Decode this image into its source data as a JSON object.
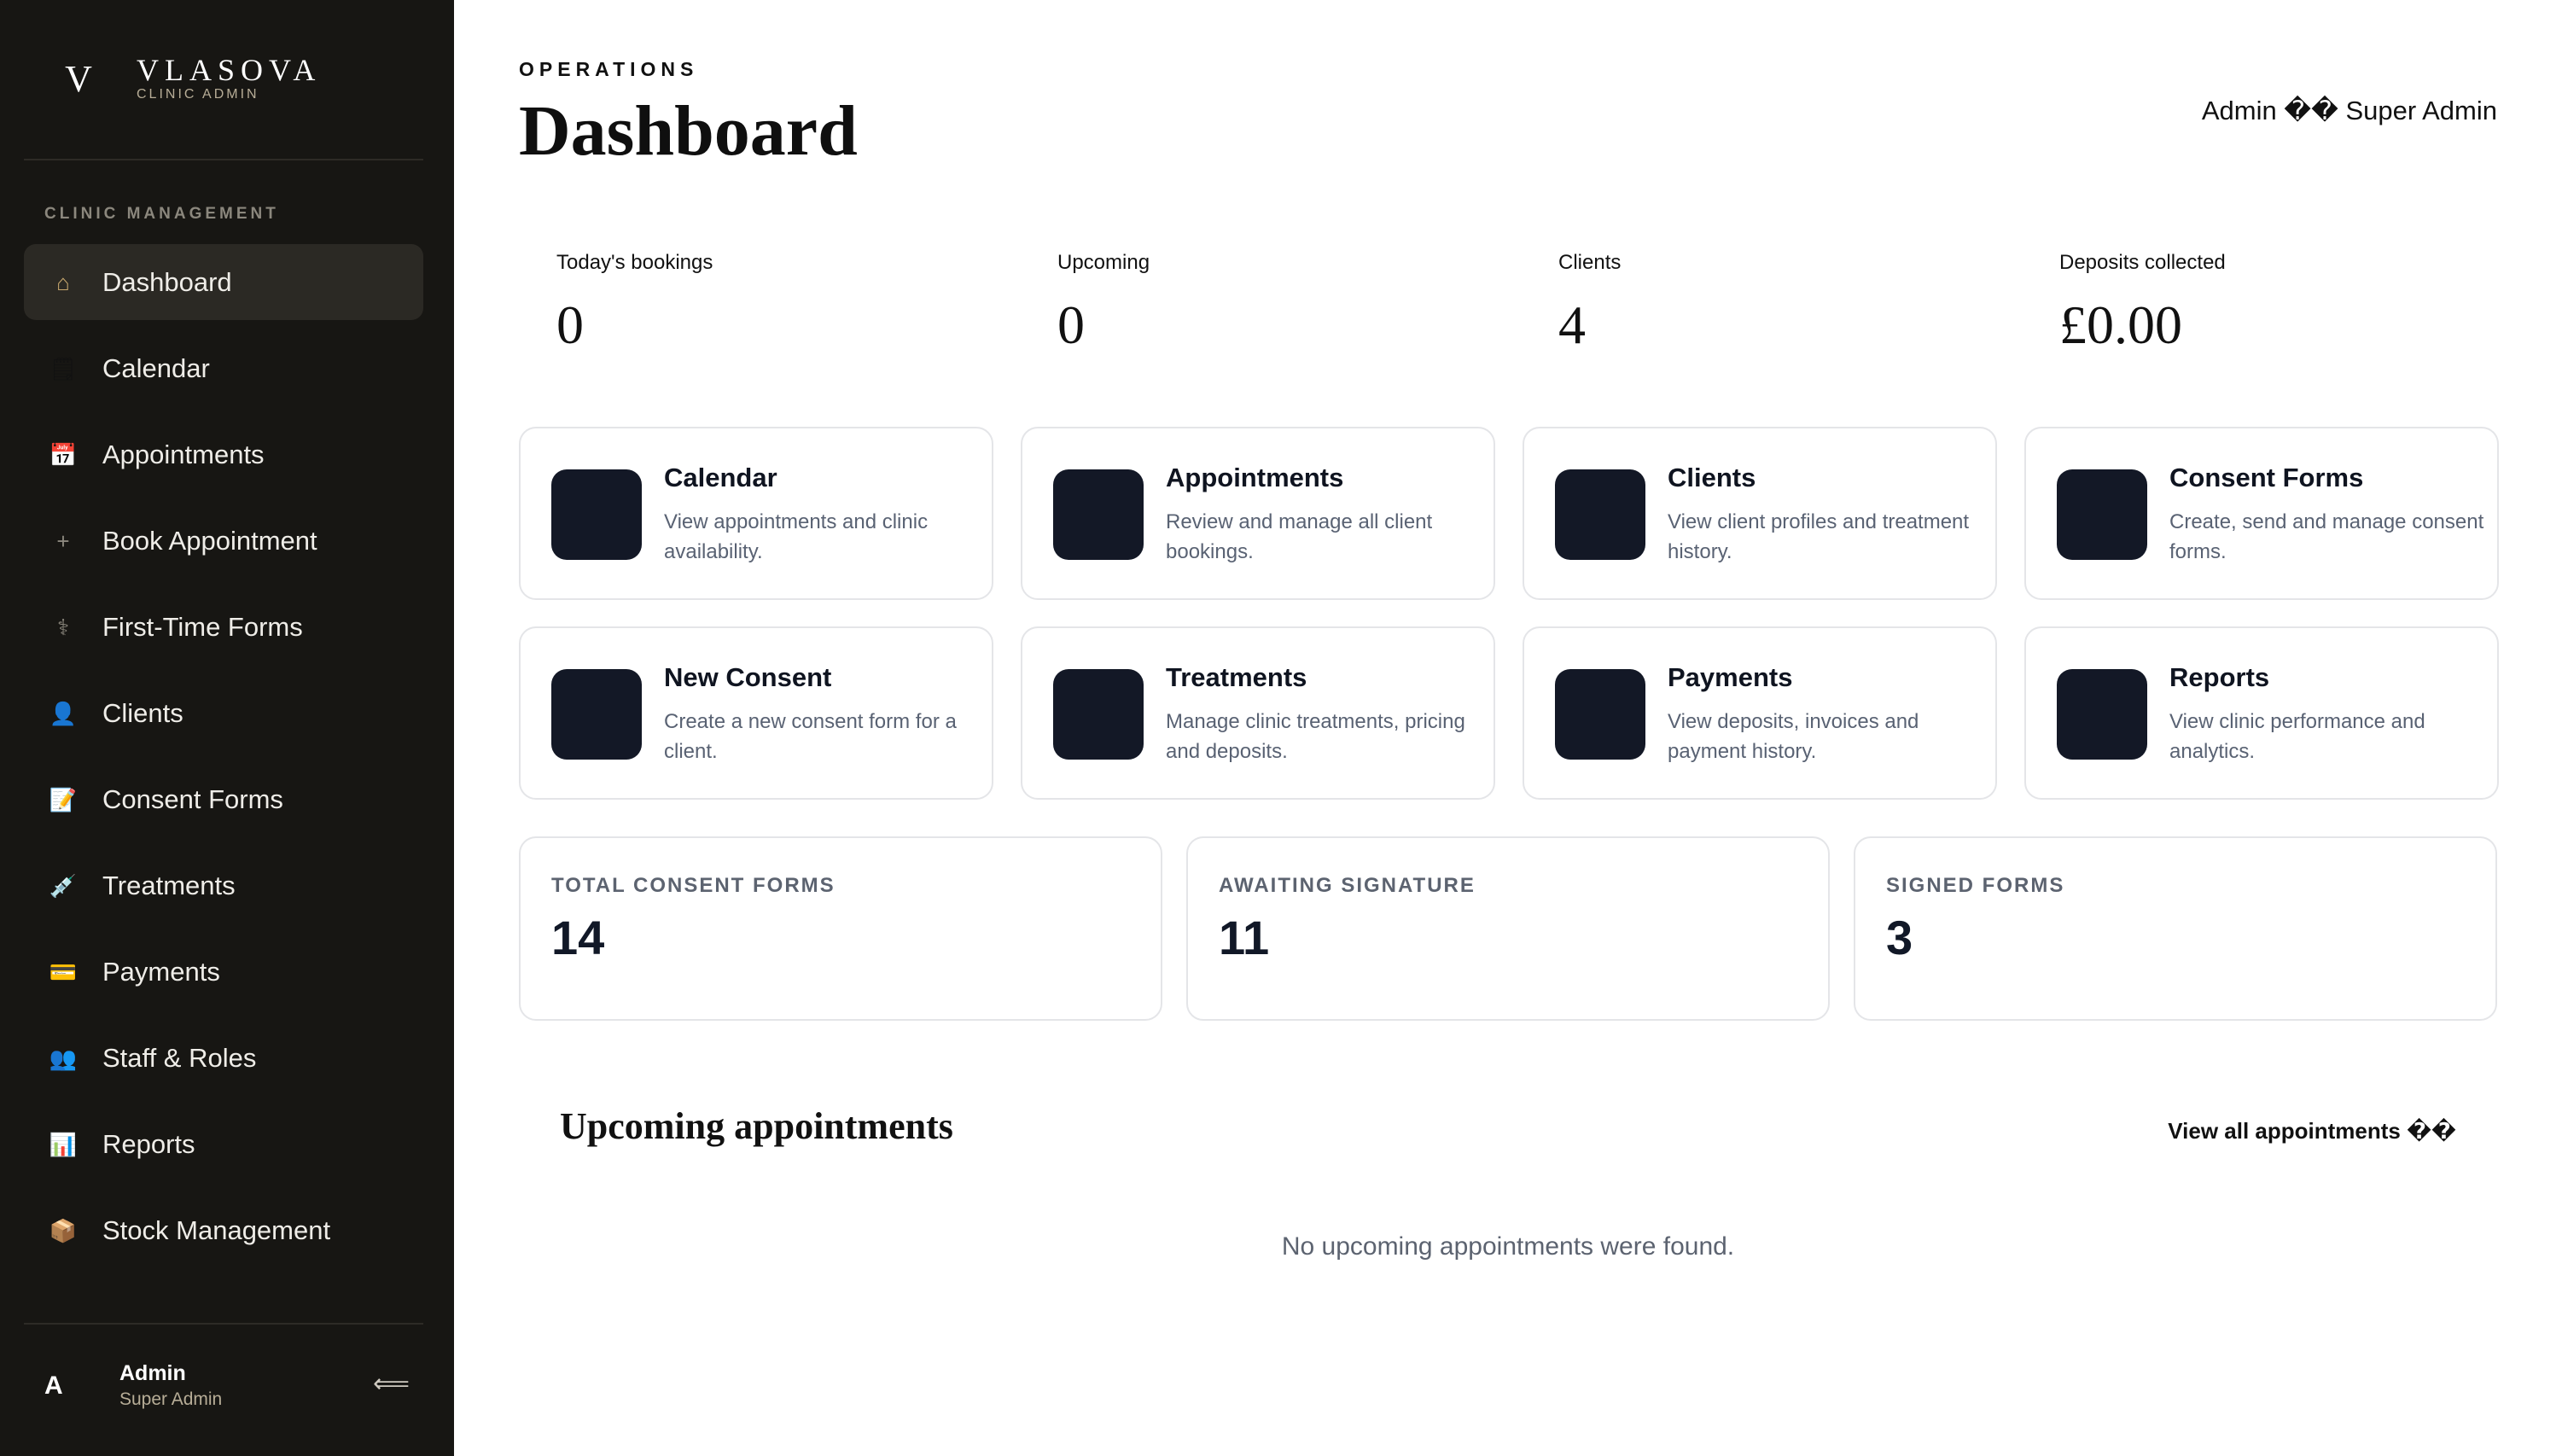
{
  "brand": {
    "mark": "V",
    "name": "VLASOVA",
    "subtitle": "CLINIC ADMIN"
  },
  "sidebar": {
    "section_label": "CLINIC MANAGEMENT",
    "items": [
      {
        "label": "Dashboard",
        "icon": "⌂",
        "icon_name": "home-icon",
        "active": true
      },
      {
        "label": "Calendar",
        "icon": "🗒",
        "icon_name": "calendar-icon"
      },
      {
        "label": "Appointments",
        "icon": "📅",
        "icon_name": "appointments-calendar-icon"
      },
      {
        "label": "Book Appointment",
        "icon": "+",
        "icon_name": "plus-icon"
      },
      {
        "label": "First-Time Forms",
        "icon": "⚕",
        "icon_name": "stethoscope-icon"
      },
      {
        "label": "Clients",
        "icon": "👤",
        "icon_name": "user-icon"
      },
      {
        "label": "Consent Forms",
        "icon": "📝",
        "icon_name": "memo-icon"
      },
      {
        "label": "Treatments",
        "icon": "💉",
        "icon_name": "syringe-icon"
      },
      {
        "label": "Payments",
        "icon": "💳",
        "icon_name": "credit-card-icon"
      },
      {
        "label": "Staff & Roles",
        "icon": "👥",
        "icon_name": "users-icon"
      },
      {
        "label": "Reports",
        "icon": "📊",
        "icon_name": "bar-chart-icon"
      },
      {
        "label": "Stock Management",
        "icon": "📦",
        "icon_name": "package-icon"
      }
    ],
    "user": {
      "avatar": "A",
      "name": "Admin",
      "role": "Super Admin",
      "logout_icon": "⟸"
    }
  },
  "header": {
    "eyebrow": "OPERATIONS",
    "title": "Dashboard",
    "admin_label": "Admin �� Super Admin"
  },
  "stats": [
    {
      "label": "Today's bookings",
      "value": "0"
    },
    {
      "label": "Upcoming",
      "value": "0"
    },
    {
      "label": "Clients",
      "value": "4"
    },
    {
      "label": "Deposits collected",
      "value": "£0.00"
    }
  ],
  "cards": [
    {
      "title": "Calendar",
      "desc": "View appointments and clinic availability."
    },
    {
      "title": "Appointments",
      "desc": "Review and manage all client bookings."
    },
    {
      "title": "Clients",
      "desc": "View client profiles and treatment history."
    },
    {
      "title": "Consent Forms",
      "desc": "Create, send and manage consent forms."
    },
    {
      "title": "New Consent",
      "desc": "Create a new consent form for a client."
    },
    {
      "title": "Treatments",
      "desc": "Manage clinic treatments, pricing and deposits."
    },
    {
      "title": "Payments",
      "desc": "View deposits, invoices and payment history."
    },
    {
      "title": "Reports",
      "desc": "View clinic performance and analytics."
    }
  ],
  "metrics": [
    {
      "label": "TOTAL CONSENT FORMS",
      "value": "14"
    },
    {
      "label": "AWAITING SIGNATURE",
      "value": "11"
    },
    {
      "label": "SIGNED FORMS",
      "value": "3"
    }
  ],
  "upcoming": {
    "title": "Upcoming appointments",
    "view_all": "View all appointments ��",
    "empty": "No upcoming appointments were found."
  },
  "colors": {
    "sidebar_bg": "#171613",
    "active_item_bg": "#2b2924",
    "card_icon_bg": "#131826",
    "accent_muted": "#b7ad97"
  }
}
